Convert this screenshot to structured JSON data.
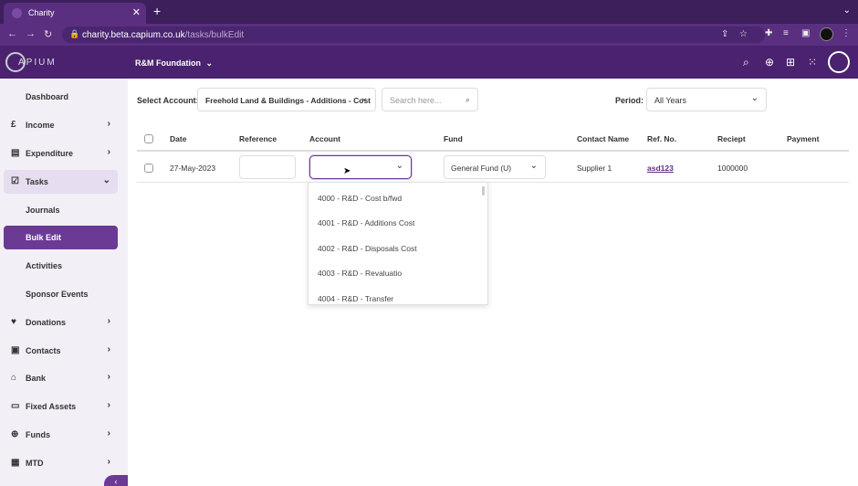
{
  "browser": {
    "tab_title": "Charity",
    "tab_close": "✕",
    "new_tab": "+",
    "url_host": "charity.beta.capium.co.uk",
    "url_path": "/tasks/bulkEdit"
  },
  "header": {
    "logo_text": "APIUM",
    "org_name": "R&M Foundation",
    "org_caret": "⌄"
  },
  "sidebar": {
    "items": [
      {
        "label": "Dashboard"
      },
      {
        "label": "Income",
        "icon": "pound-icon"
      },
      {
        "label": "Expenditure",
        "icon": "bag-icon"
      },
      {
        "label": "Tasks",
        "icon": "tasks-icon"
      },
      {
        "label": "Journals"
      },
      {
        "label": "Bulk Edit"
      },
      {
        "label": "Activities"
      },
      {
        "label": "Sponsor Events"
      },
      {
        "label": "Donations",
        "icon": "donations-icon"
      },
      {
        "label": "Contacts",
        "icon": "contacts-icon"
      },
      {
        "label": "Bank",
        "icon": "bank-icon"
      },
      {
        "label": "Fixed Assets",
        "icon": "assets-icon"
      },
      {
        "label": "Funds",
        "icon": "funds-icon"
      },
      {
        "label": "MTD",
        "icon": "mtd-icon"
      }
    ]
  },
  "filters": {
    "select_account_label": "Select Account:",
    "select_account_value": "Freehold Land & Buildings - Additions - Cost",
    "search_placeholder": "Search here...",
    "period_label": "Period:",
    "period_value": "All Years"
  },
  "table": {
    "headers": [
      "Date",
      "Reference",
      "Account",
      "Fund",
      "Contact Name",
      "Ref. No.",
      "Reciept",
      "Payment"
    ],
    "row": {
      "date": "27-May-2023",
      "reference": "",
      "account": "",
      "fund": "General Fund (U)",
      "contact_name": "Supplier 1",
      "ref_no": "asd123",
      "receipt": "1000000",
      "payment": ""
    }
  },
  "account_dropdown": {
    "options": [
      "4000 - R&D - Cost b/fwd",
      "4001 - R&D - Additions Cost",
      "4002 - R&D - Disposals Cost",
      "4003 - R&D - Revaluatio",
      "4004 - R&D - Transfer"
    ]
  },
  "colors": {
    "brand": "#4a2270",
    "active": "#6b3a94"
  }
}
